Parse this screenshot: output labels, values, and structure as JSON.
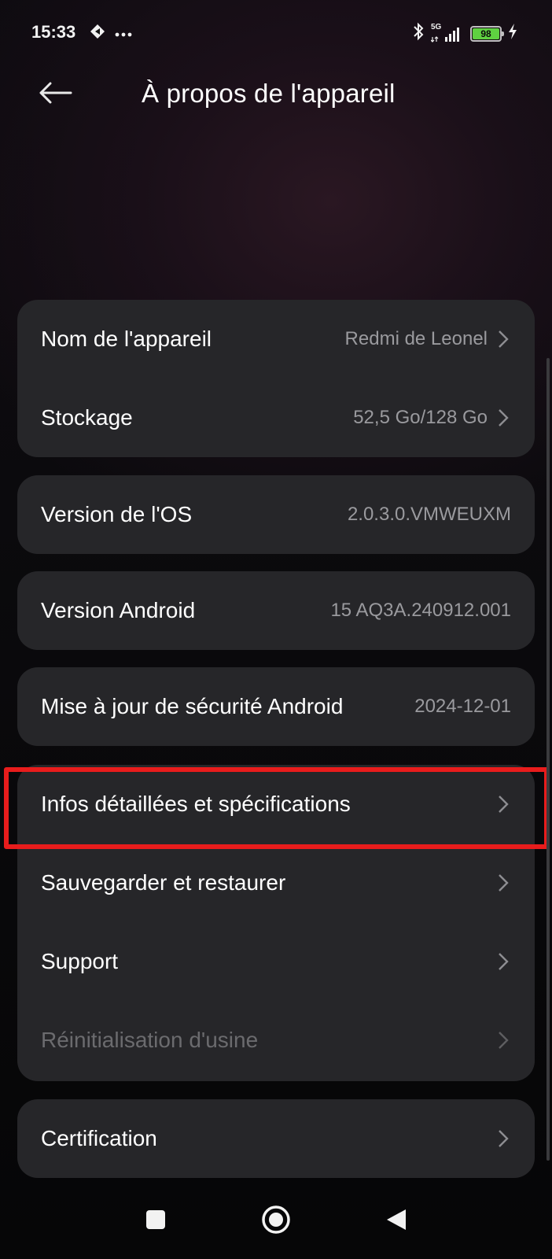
{
  "status_bar": {
    "time": "15:33",
    "icons_left": [
      "notification-app-icon",
      "more-dots-icon"
    ],
    "network": "5G",
    "battery": "98",
    "icons_right": [
      "bluetooth-icon",
      "signal-icon",
      "battery-icon",
      "charging-icon"
    ]
  },
  "header": {
    "back_icon": "arrow-left-icon",
    "title": "À propos de l'appareil"
  },
  "cards": [
    {
      "rows": [
        {
          "label": "Nom de l'appareil",
          "value": "Redmi de Leonel",
          "chevron": true
        },
        {
          "label": "Stockage",
          "value": "52,5 Go/128 Go",
          "chevron": true
        }
      ]
    },
    {
      "rows": [
        {
          "label": "Version de l'OS",
          "value": "2.0.3.0.VMWEUXM",
          "chevron": false
        }
      ]
    },
    {
      "rows": [
        {
          "label": "Version Android",
          "value": "15 AQ3A.240912.001",
          "chevron": false
        }
      ]
    },
    {
      "rows": [
        {
          "label": "Mise à jour de sécurité Android",
          "value": "2024-12-01",
          "chevron": false
        }
      ]
    },
    {
      "rows": [
        {
          "label": "Infos détaillées et spécifications",
          "chevron": true,
          "highlighted": true
        },
        {
          "label": "Sauvegarder et restaurer",
          "chevron": true
        },
        {
          "label": "Support",
          "chevron": true
        },
        {
          "label": "Réinitialisation d'usine",
          "chevron": true,
          "disabled": true
        }
      ]
    },
    {
      "rows": [
        {
          "label": "Certification",
          "chevron": true
        }
      ]
    }
  ],
  "nav_bar": {
    "buttons": [
      "recents-square-icon",
      "home-circle-icon",
      "back-triangle-icon"
    ]
  },
  "colors": {
    "card": "#262629",
    "highlight": "#e81c1c",
    "secondary_text": "#9a9a9e",
    "battery": "#5fd141"
  }
}
